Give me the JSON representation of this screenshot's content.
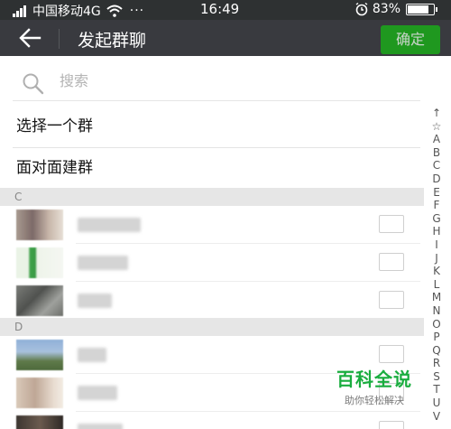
{
  "status_bar": {
    "carrier": "中国移动4G",
    "dots": "···",
    "time": "16:49",
    "battery_percent": "83%",
    "battery_level": 0.83,
    "icons": [
      "signal-icon",
      "wifi-icon",
      "alarm-icon",
      "battery-icon"
    ]
  },
  "nav": {
    "back_icon": "arrow-left-icon",
    "title": "发起群聊",
    "confirm_label": "确定"
  },
  "search": {
    "placeholder": "搜索",
    "icon": "search-icon"
  },
  "options": [
    {
      "label": "选择一个群"
    },
    {
      "label": "面对面建群"
    }
  ],
  "sections": [
    {
      "header": "C",
      "contacts": [
        {
          "checked": false
        },
        {
          "checked": false
        },
        {
          "checked": false
        }
      ]
    },
    {
      "header": "D",
      "contacts": [
        {
          "checked": false
        },
        {
          "checked": false
        },
        {
          "checked": false
        }
      ]
    }
  ],
  "alpha_index": [
    "↑",
    "☆",
    "A",
    "B",
    "C",
    "D",
    "E",
    "F",
    "G",
    "H",
    "I",
    "J",
    "K",
    "L",
    "M",
    "N",
    "O",
    "P",
    "Q",
    "R",
    "S",
    "T",
    "U",
    "V"
  ],
  "watermark": {
    "title": "百科全说",
    "subtitle": "助你轻松解决"
  },
  "colors": {
    "status_bar": "#2e3132",
    "nav_bar": "#393a3f",
    "confirm": "#1aad19",
    "section_header": "#e6e6e6",
    "watermark": "#1aad3f"
  }
}
